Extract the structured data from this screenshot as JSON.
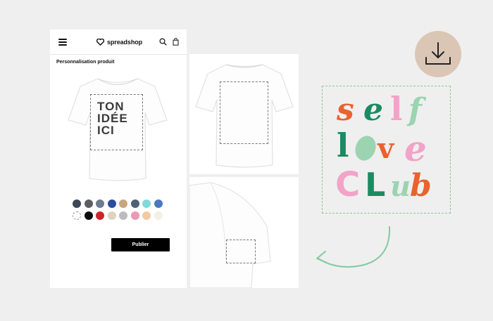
{
  "header": {
    "logo_text": "spreadshop",
    "icons": [
      "menu-icon",
      "heart-logo-icon",
      "search-icon",
      "shopping-bag-icon"
    ]
  },
  "page": {
    "title": "Personnalisation produit",
    "design_lines": [
      "TON",
      "IDÉE",
      "ICI"
    ],
    "publish_label": "Publier"
  },
  "swatches": [
    "#3d4756",
    "#5b5d61",
    "#6e7a8f",
    "#2a4d9c",
    "#c8a67d",
    "#4c6277",
    "#7fdada",
    "#4a78c2",
    "#ffffff",
    "#0c0c0c",
    "#d0242b",
    "#ddd4c0",
    "#bcbcbc",
    "#e999b5",
    "#f3c9a1",
    "#f5f0e2"
  ],
  "artwork": {
    "words": [
      "self",
      "love",
      "club"
    ],
    "colors": {
      "orange": "#e8632e",
      "green": "#1c8a63",
      "pink": "#f2a3c7",
      "mint": "#9cd3b0"
    }
  },
  "accents": {
    "download_bg": "#dbc6b6",
    "dashed_border": "#8ac89a",
    "arrow": "#82caa0"
  }
}
